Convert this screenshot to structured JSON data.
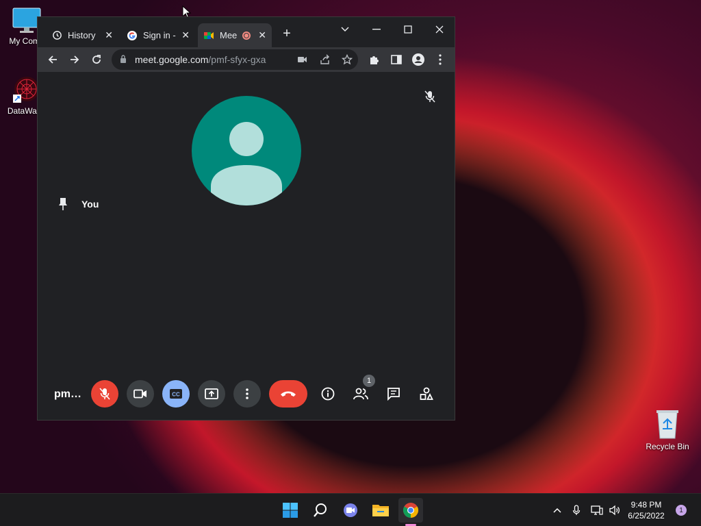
{
  "desktop": {
    "icons": [
      {
        "label": "My Comp",
        "icon": "monitor-icon"
      },
      {
        "label": "DataWago",
        "icon": "datawagon-app-icon"
      },
      {
        "label": "Recycle Bin",
        "icon": "recycle-bin-icon"
      }
    ]
  },
  "browser": {
    "tabs": [
      {
        "label": "History",
        "icon": "history-icon"
      },
      {
        "label": "Sign in -",
        "icon": "google-icon"
      },
      {
        "label": "Mee",
        "icon": "google-meet-icon",
        "recording": true
      }
    ],
    "new_tab_label": "+",
    "url_host": "meet.google.com",
    "url_path": "/pmf-sfyx-gxa"
  },
  "meet": {
    "participant_name": "You",
    "meeting_code_short": "pm…",
    "participant_count": "1",
    "colors": {
      "avatar": "#00897b",
      "danger": "#ea4335",
      "captions_on": "#8ab4f8"
    }
  },
  "taskbar": {
    "time": "9:48 PM",
    "date": "6/25/2022",
    "notification_count": "1"
  }
}
